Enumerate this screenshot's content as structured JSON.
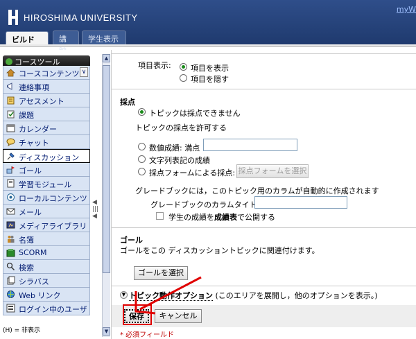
{
  "header": {
    "university": "HIROSHIMA UNIVERSITY",
    "my_link": "myW",
    "tabs": [
      {
        "label": "ビルド"
      },
      {
        "label": "講師"
      },
      {
        "label": "学生表示"
      }
    ]
  },
  "sidebar": {
    "heading": "コースツール",
    "items": [
      {
        "label": "コースコンテンツ",
        "icon": "house-icon"
      },
      {
        "label": "連絡事項",
        "icon": "megaphone-icon"
      },
      {
        "label": "アセスメント",
        "icon": "clipboard-icon"
      },
      {
        "label": "課題",
        "icon": "assignment-icon"
      },
      {
        "label": "カレンダー",
        "icon": "calendar-icon"
      },
      {
        "label": "チャット",
        "icon": "chat-icon"
      },
      {
        "label": "ディスカッション",
        "icon": "pushpin-icon"
      },
      {
        "label": "ゴール",
        "icon": "goal-flag-icon"
      },
      {
        "label": "学習モジュール",
        "icon": "module-icon"
      },
      {
        "label": "ローカルコンテンツ",
        "icon": "local-content-icon"
      },
      {
        "label": "メール",
        "icon": "mail-icon"
      },
      {
        "label": "メディアライブラリ",
        "icon": "media-library-icon"
      },
      {
        "label": "名簿",
        "icon": "people-icon"
      },
      {
        "label": "SCORM",
        "icon": "scorm-icon"
      },
      {
        "label": "検索",
        "icon": "magnifier-icon"
      },
      {
        "label": "シラバス",
        "icon": "syllabus-icon"
      },
      {
        "label": "Web リンク",
        "icon": "web-link-icon"
      },
      {
        "label": "ログイン中のユーザ",
        "icon": "user-list-icon"
      }
    ],
    "legend": "(H) = 非表示"
  },
  "main": {
    "display": {
      "label": "項目表示:",
      "show": "項目を表示",
      "hide": "項目を隠す"
    },
    "grading": {
      "title": "採点",
      "not_gradable": "トピックは採点できません",
      "allow_grading": "トピックの採点を許可する",
      "numeric": "数値成績: 満点",
      "numeric_value": "",
      "string": "文字列表記の成績",
      "form": "採点フォームによる採点:",
      "select_form_button": "採点フォームを選択",
      "gradebook_note": "グレードブックには，このトピック用のカラムが自動的に作成されます",
      "column_title_label": "グレードブックのカラムタイトル:",
      "column_title_value": "",
      "publish_prefix": "学生の成績を",
      "publish_bold": "成績表",
      "publish_suffix": "で公開する"
    },
    "goal": {
      "title": "ゴール",
      "description": "ゴールをこの ディスカッショントピックに関連付けます。",
      "select_button": "ゴールを選択"
    },
    "options": {
      "link": "トピック動作オプション",
      "hint": "(このエリアを展開し，他のオプションを表示。)"
    },
    "actions": {
      "save": "保存",
      "cancel": "キャンセル",
      "required": "* 必須フィールド"
    }
  },
  "colors": {
    "header": "#2f4e8a",
    "nav_bg": "#d9e4f4",
    "required": "#c00000",
    "annotation_arrow": "#e00000"
  }
}
